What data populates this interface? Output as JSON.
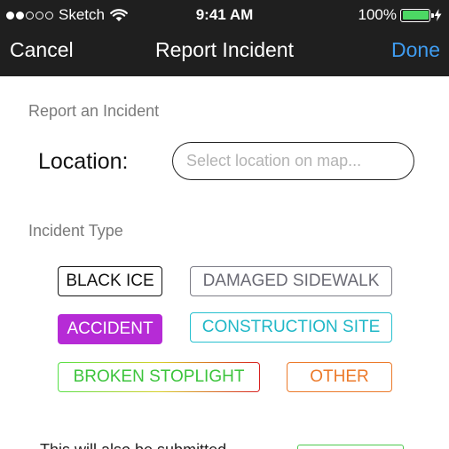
{
  "status_bar": {
    "carrier": "Sketch",
    "time": "9:41 AM",
    "battery_percent": "100%",
    "battery_level": 1.0,
    "signal_bars_filled": 2,
    "signal_bars_total": 5,
    "battery_color": "#4cd964"
  },
  "nav": {
    "cancel_label": "Cancel",
    "title": "Report Incident",
    "done_label": "Done",
    "done_color": "#3f9cf0"
  },
  "form": {
    "section_heading": "Report an Incident",
    "location_label": "Location:",
    "location_value": "",
    "location_placeholder": "Select location on map...",
    "incident_type_heading": "Incident Type",
    "incident_types": [
      {
        "label": "BLACK ICE",
        "color": "#111111",
        "selected": false
      },
      {
        "label": "DAMAGED SIDEWALK",
        "color": "#6a6a74",
        "selected": false
      },
      {
        "label": "ACCIDENT",
        "color": "#b62bd6",
        "selected": true
      },
      {
        "label": "CONSTRUCTION SITE",
        "color": "#1fb7c7",
        "selected": false
      },
      {
        "label": "BROKEN STOPLIGHT",
        "color": "#3cc43c",
        "selected": false
      },
      {
        "label": "OTHER",
        "color": "#ec7a2a",
        "selected": false
      }
    ],
    "footer_text": "This will also be submitted"
  }
}
